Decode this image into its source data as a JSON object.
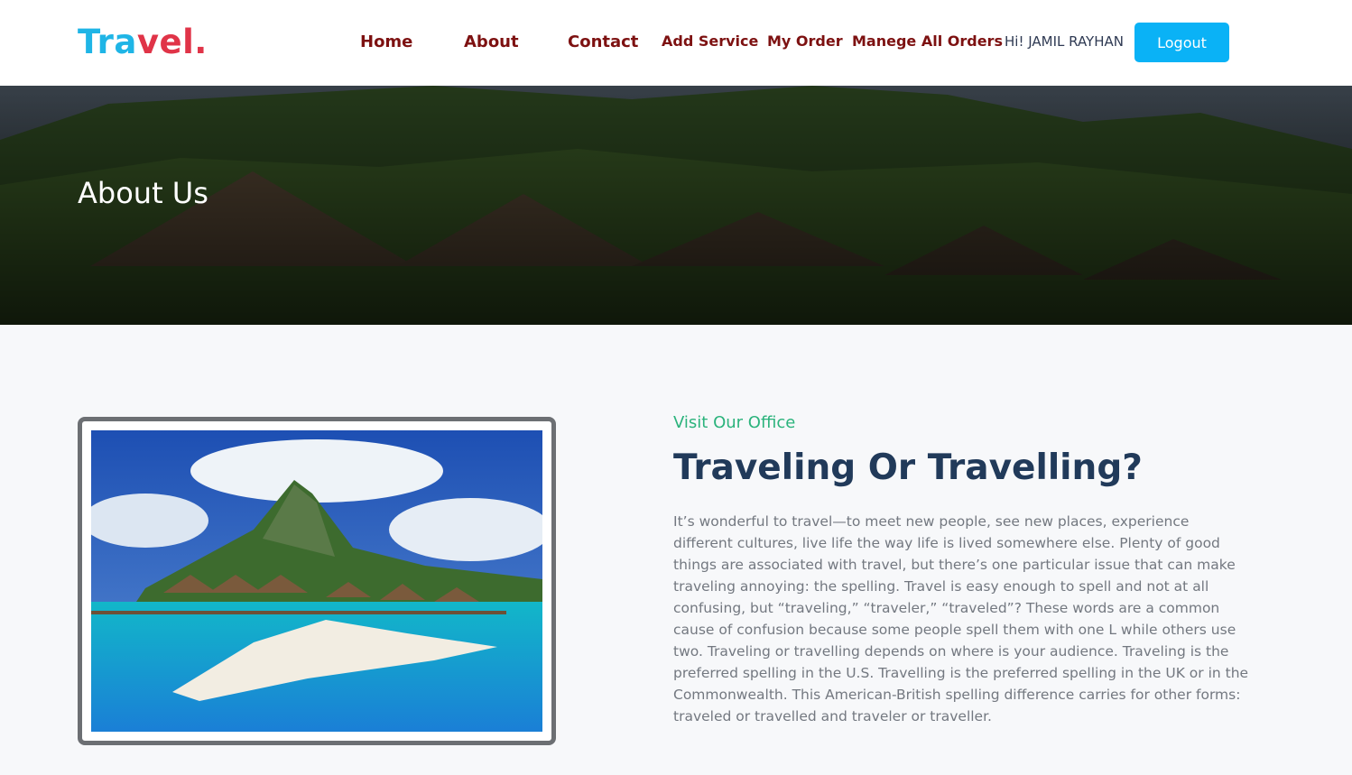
{
  "brand": {
    "part1": "Tra",
    "part2": "vel",
    "dot": "."
  },
  "nav": {
    "home": "Home",
    "about": "About",
    "contact": "Contact",
    "add_service": "Add Service",
    "my_order": "My Order",
    "manage_orders": "Manege All Orders",
    "greeting": "Hi! JAMIL RAYHAN",
    "logout": "Logout"
  },
  "hero": {
    "title": "About Us"
  },
  "about": {
    "eyebrow": "Visit Our Office",
    "headline": "Traveling Or Travelling?",
    "body": "It’s wonderful to travel—to meet new people, see new places, experience different cultures, live life the way life is lived somewhere else. Plenty of good things are associated with travel, but there’s one particular issue that can make traveling annoying: the spelling. Travel is easy enough to spell and not at all confusing, but “traveling,” “traveler,” “traveled”? These words are a common cause of confusion because some people spell them with one L while others use two. Traveling or travelling depends on where is your audience. Traveling is the preferred spelling in the U.S. Travelling is the preferred spelling in the UK or in the Commonwealth. This American-British spelling difference carries for other forms: traveled or travelled and traveler or traveller."
  },
  "colors": {
    "brand_blue": "#1fb5e6",
    "brand_red": "#e03448",
    "nav_link": "#7d1111",
    "logout_bg": "#0ab2f6",
    "eyebrow": "#2bb37c",
    "headline": "#213a5a"
  }
}
